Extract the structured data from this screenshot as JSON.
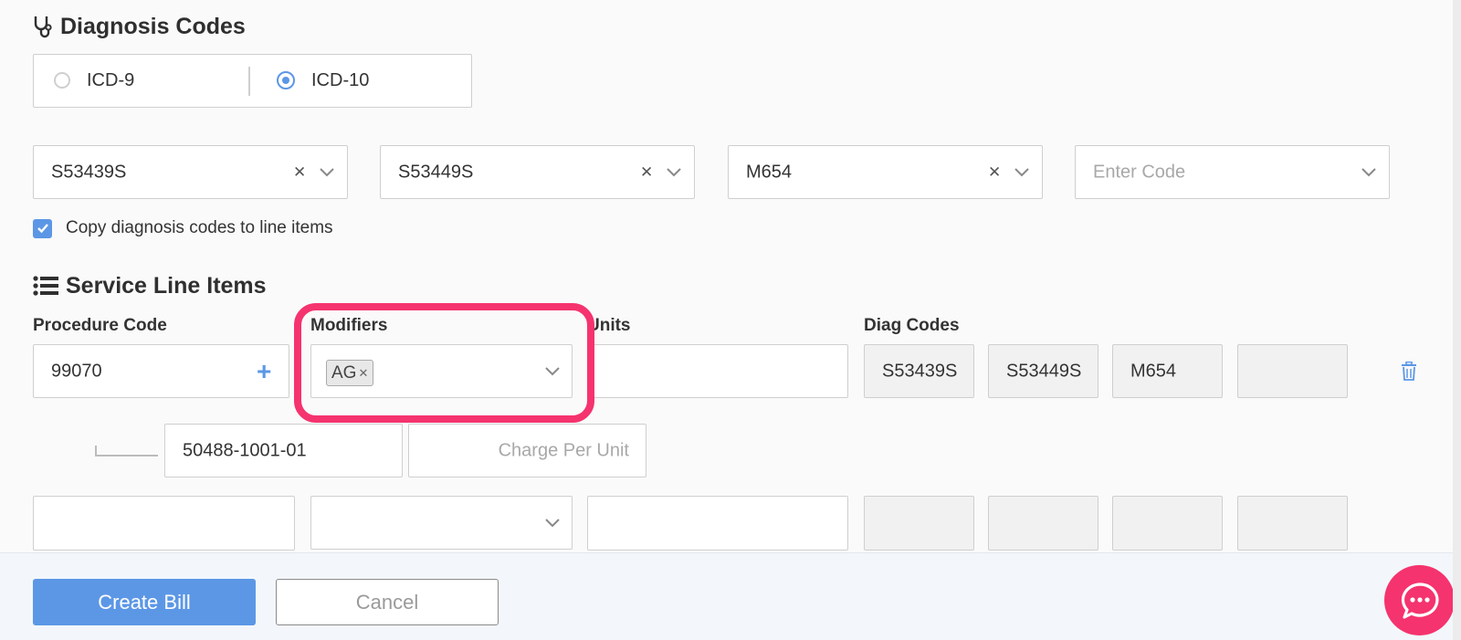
{
  "diagnosis": {
    "title": "Diagnosis Codes",
    "code_sets": [
      {
        "label": "ICD-9",
        "selected": false
      },
      {
        "label": "ICD-10",
        "selected": true
      }
    ],
    "codes": [
      "S53439S",
      "S53449S",
      "M654"
    ],
    "enter_placeholder": "Enter Code",
    "copy_checkbox_label": "Copy diagnosis codes to line items",
    "copy_checked": true
  },
  "service": {
    "title": "Service Line Items",
    "columns": {
      "procedure_code": "Procedure Code",
      "modifiers": "Modifiers",
      "units": "Units",
      "diag_codes": "Diag Codes"
    },
    "row1": {
      "procedure_code": "99070",
      "modifier_tag": "AG",
      "units": "",
      "diag_codes": [
        "S53439S",
        "S53449S",
        "M654",
        ""
      ],
      "ndc": "50488-1001-01",
      "charge_placeholder": "Charge Per Unit"
    }
  },
  "footer": {
    "create_label": "Create Bill",
    "cancel_label": "Cancel"
  },
  "colors": {
    "accent_blue": "#5c97e6",
    "highlight_pink": "#f5336e"
  }
}
